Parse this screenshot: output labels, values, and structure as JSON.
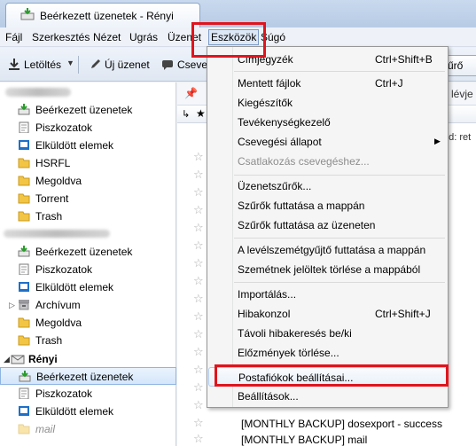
{
  "window": {
    "tab_title": "Beérkezett üzenetek - Rényi"
  },
  "menubar": {
    "items": [
      "Fájl",
      "Szerkesztés",
      "Nézet",
      "Ugrás",
      "Üzenet",
      "Eszközök",
      "Súgó"
    ]
  },
  "toolbar": {
    "get_mail": "Letöltés",
    "new_message": "Új üzenet",
    "chat": "Cseve",
    "right_partial": "űrő"
  },
  "folders": {
    "account1": [
      {
        "label": "Beérkezett üzenetek",
        "icon": "inbox-icon"
      },
      {
        "label": "Piszkozatok",
        "icon": "drafts-icon"
      },
      {
        "label": "Elküldött elemek",
        "icon": "sent-icon"
      },
      {
        "label": "HSRFL",
        "icon": "folder-icon"
      },
      {
        "label": "Megoldva",
        "icon": "folder-icon"
      },
      {
        "label": "Torrent",
        "icon": "folder-icon"
      },
      {
        "label": "Trash",
        "icon": "folder-icon"
      }
    ],
    "account2": [
      {
        "label": "Beérkezett üzenetek",
        "icon": "inbox-icon"
      },
      {
        "label": "Piszkozatok",
        "icon": "drafts-icon"
      },
      {
        "label": "Elküldött elemek",
        "icon": "sent-icon"
      },
      {
        "label": "Archívum",
        "icon": "archive-icon"
      },
      {
        "label": "Megoldva",
        "icon": "folder-icon"
      },
      {
        "label": "Trash",
        "icon": "folder-icon"
      }
    ],
    "account3_name": "Rényi",
    "account3": [
      {
        "label": "Beérkezett üzenetek",
        "icon": "inbox-icon"
      },
      {
        "label": "Piszkozatok",
        "icon": "drafts-icon"
      },
      {
        "label": "Elküldött elemek",
        "icon": "sent-icon"
      },
      {
        "label": "mail",
        "icon": "folder-icon"
      }
    ]
  },
  "messages": {
    "header_partial": "lévje",
    "filter_partial": "ed: ret",
    "rows": [
      "[MONTHLY BACKUP] dosexport - success",
      "[MONTHLY BACKUP] mail"
    ]
  },
  "tools_menu": {
    "items": [
      {
        "label": "Címjegyzék",
        "shortcut": "Ctrl+Shift+B"
      },
      {
        "label": "Mentett fájlok",
        "shortcut": "Ctrl+J"
      },
      {
        "label": "Kiegészítők",
        "shortcut": ""
      },
      {
        "label": "Tevékenységkezelő",
        "shortcut": ""
      },
      {
        "label": "Csevegési állapot",
        "shortcut": ""
      },
      {
        "label": "Csatlakozás csevegéshez...",
        "shortcut": ""
      },
      {
        "label": "Üzenetszűrők...",
        "shortcut": ""
      },
      {
        "label": "Szűrők futtatása a mappán",
        "shortcut": ""
      },
      {
        "label": "Szűrők futtatása az üzeneten",
        "shortcut": ""
      },
      {
        "label": "A levélszemétgyűjtő futtatása a mappán",
        "shortcut": ""
      },
      {
        "label": "Szemétnek jelöltek törlése a mappából",
        "shortcut": ""
      },
      {
        "label": "Importálás...",
        "shortcut": ""
      },
      {
        "label": "Hibakonzol",
        "shortcut": "Ctrl+Shift+J"
      },
      {
        "label": "Távoli hibakeresés be/ki",
        "shortcut": ""
      },
      {
        "label": "Előzmények törlése...",
        "shortcut": ""
      },
      {
        "label": "Postafiókok beállításai...",
        "shortcut": ""
      },
      {
        "label": "Beállítások...",
        "shortcut": ""
      }
    ]
  },
  "colors": {
    "highlight_red": "#e0141e",
    "selection_blue": "#d4e6fb"
  }
}
